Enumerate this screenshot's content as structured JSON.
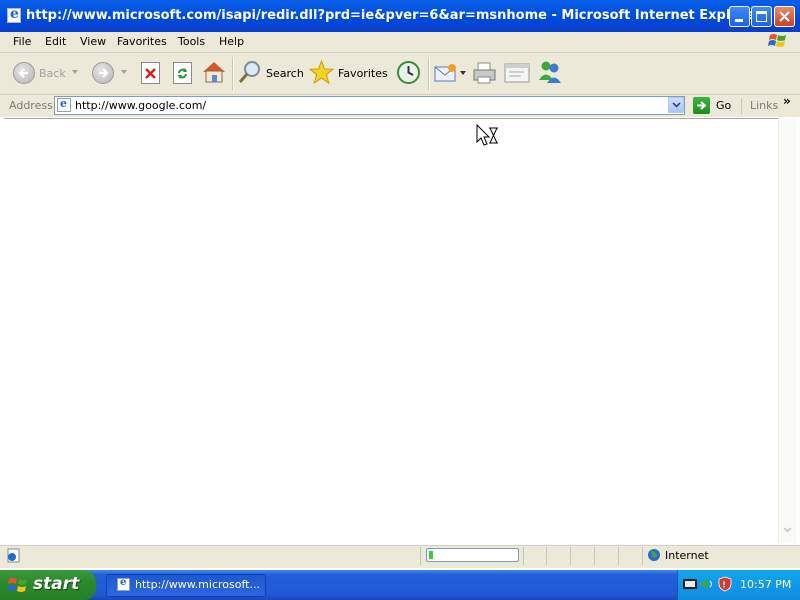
{
  "window": {
    "title": "http://www.microsoft.com/isapi/redir.dll?prd=ie&pver=6&ar=msnhome - Microsoft Internet Explorer"
  },
  "menu": [
    "File",
    "Edit",
    "View",
    "Favorites",
    "Tools",
    "Help"
  ],
  "toolbar": {
    "back_label": "Back",
    "search_label": "Search",
    "favorites_label": "Favorites"
  },
  "address": {
    "label": "Address",
    "value": "http://www.google.com/",
    "go_label": "Go",
    "links_label": "Links"
  },
  "status": {
    "zone": "Internet",
    "progress": 0.05
  },
  "taskbar": {
    "start_label": "start",
    "task_label": "http://www.microsoft...",
    "clock": "10:57 PM"
  },
  "colors": {
    "titlebar": "#0053e1",
    "chrome": "#ece9d8",
    "taskbar": "#245edb",
    "start": "#2c8a2c",
    "tray": "#0f8bdd"
  }
}
